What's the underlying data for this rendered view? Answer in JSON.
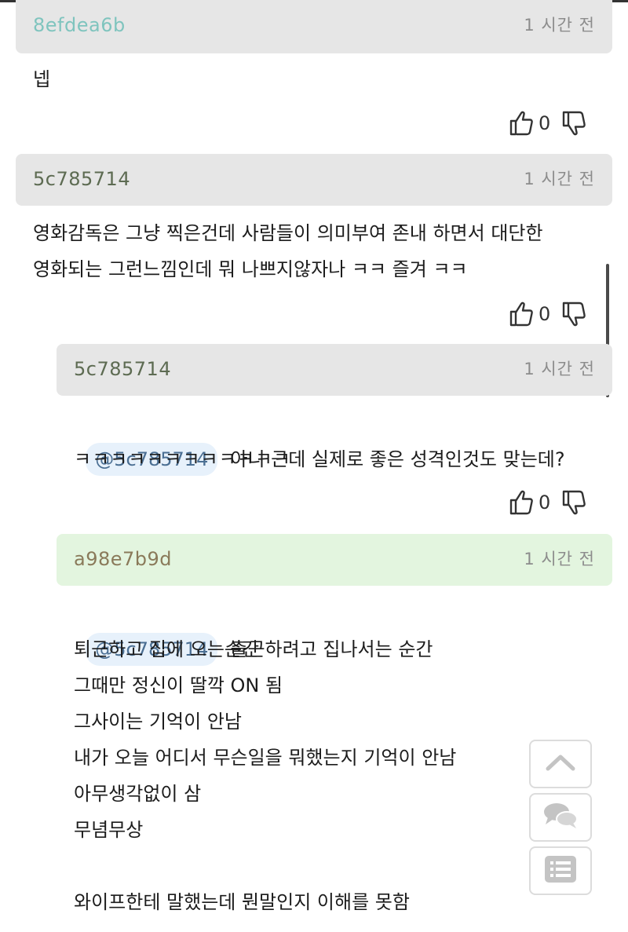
{
  "comments": [
    {
      "author": "8efdea6b",
      "time": "1 시간 전",
      "text": "넵",
      "likes": "0"
    },
    {
      "author": "5c785714",
      "time": "1 시간 전",
      "text": "영화감독은 그냥 찍은건데 사람들이 의미부여 존내 하면서 대단한\n영화되는 그런느낌인데 뭐 나쁘지않자나 ㅋㅋ 즐겨 ㅋㅋ",
      "likes": "0"
    },
    {
      "author": "5c785714",
      "time": "1 시간 전",
      "mention": "@5c785714",
      "text_line1": "아니 근데 실제로 좋은 성격인것도 맞는데?",
      "text_line2": "ㅋㅋㅋㅋㅋㅋㅋㅋㅋㅋㅋㅋ",
      "likes": "0"
    },
    {
      "author": "a98e7b9d",
      "time": "1 시간 전",
      "mention": "@5c785714",
      "text_line1": "출근하려고 집나서는 순간",
      "text_rest": "퇴근하고 집에 오는순간\n그때만 정신이 딸깍 ON 됨\n그사이는 기억이 안남\n내가 오늘 어디서 무슨일을 뭐했는지 기억이 안남\n아무생각없이 삼\n무념무상\n\n와이프한테 말했는데 뭔말인지 이해를 못함"
    }
  ],
  "float_buttons": {
    "up": "chevron-up-icon",
    "chat": "chat-icon",
    "list": "list-icon"
  }
}
